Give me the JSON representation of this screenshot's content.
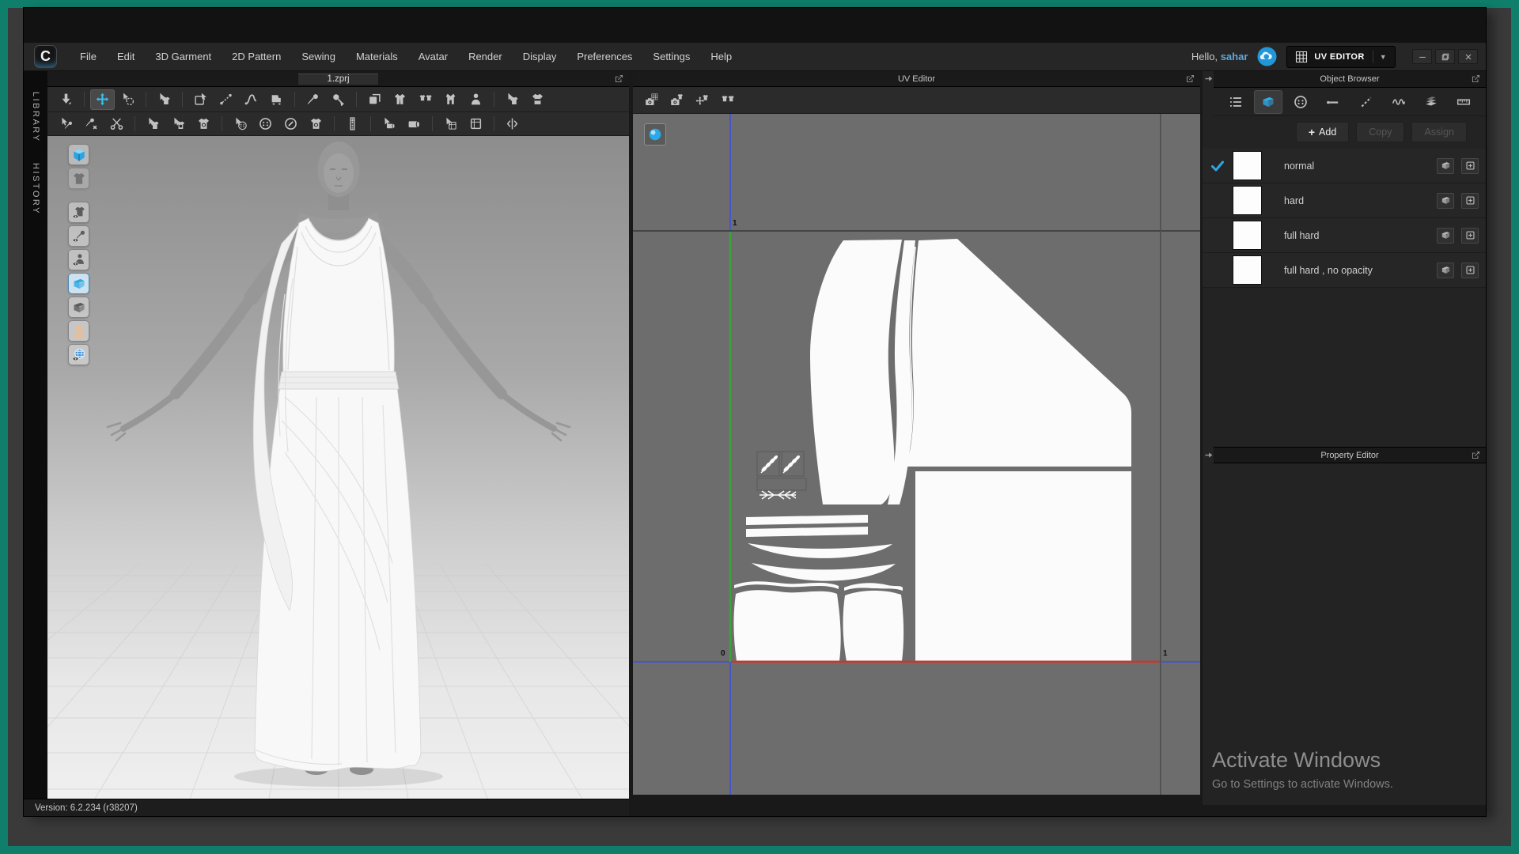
{
  "colors": {
    "frame_teal": "#0f7f6b",
    "accent_blue": "#2ba7e8",
    "account_name_blue": "#5fa8dd",
    "uv_left_edge_green": "#3aa33a",
    "uv_bottom_edge_red": "#c23b2e",
    "uv_axis_blue": "#4656c4",
    "uv_background_gray": "#6d6d6d"
  },
  "window": {
    "logo": "C",
    "menu_items": [
      "File",
      "Edit",
      "3D Garment",
      "2D Pattern",
      "Sewing",
      "Materials",
      "Avatar",
      "Render",
      "Display",
      "Preferences",
      "Settings",
      "Help"
    ],
    "greeting_prefix": "Hello,",
    "greeting_name": "sahar",
    "mode_switcher": {
      "label": "UV EDITOR",
      "icon": "uv-grid"
    },
    "controls": [
      {
        "name": "minimize",
        "glyph": "min"
      },
      {
        "name": "restore",
        "glyph": "restore"
      },
      {
        "name": "close",
        "glyph": "close"
      }
    ]
  },
  "left_rail": {
    "tabs": [
      {
        "name": "library",
        "label": "LIBRARY"
      },
      {
        "name": "history",
        "label": "HISTORY"
      }
    ]
  },
  "garment_panel": {
    "tab_title": "1.zprj",
    "version_label": "Version: 6.2.234 (r38207)",
    "toolbar_row1": [
      {
        "name": "simulate",
        "glyph": "arrowdown"
      },
      {
        "sep": true
      },
      {
        "name": "select-move",
        "glyph": "move",
        "active": true
      },
      {
        "name": "select-lasso",
        "glyph": "lasso"
      },
      {
        "sep": true
      },
      {
        "name": "select-mesh",
        "glyph": "cursshirt"
      },
      {
        "sep": true
      },
      {
        "name": "edit-pattern",
        "glyph": "sqcursor"
      },
      {
        "name": "edit-sewing",
        "glyph": "seam"
      },
      {
        "name": "free-sewing",
        "glyph": "curve"
      },
      {
        "name": "sewing-machine",
        "glyph": "machine"
      },
      {
        "sep": true
      },
      {
        "name": "pin-tack",
        "glyph": "pin"
      },
      {
        "name": "tack-on-avatar",
        "glyph": "pinball"
      },
      {
        "sep": true
      },
      {
        "name": "fold-arrangement",
        "glyph": "layers"
      },
      {
        "name": "solidify-garment",
        "glyph": "jacket"
      },
      {
        "name": "arrangement-points",
        "glyph": "shirts"
      },
      {
        "name": "bounding-volume",
        "glyph": "vest"
      },
      {
        "name": "avatar-tape",
        "glyph": "person"
      },
      {
        "sep": true
      },
      {
        "name": "garment-tape",
        "glyph": "cursshirt"
      },
      {
        "name": "garment-measure",
        "glyph": "shirtband"
      }
    ],
    "toolbar_row2": [
      {
        "name": "edit-pin",
        "glyph": "curspin"
      },
      {
        "name": "remove-pin",
        "glyph": "pinx"
      },
      {
        "name": "trim-cut",
        "glyph": "scissors"
      },
      {
        "sep": true
      },
      {
        "name": "edit-texture",
        "glyph": "cursshirt"
      },
      {
        "name": "edit-applique",
        "glyph": "cursbtnshirt"
      },
      {
        "name": "applique",
        "glyph": "btnshirt"
      },
      {
        "sep": true
      },
      {
        "name": "edit-button",
        "glyph": "cursbutton"
      },
      {
        "name": "button",
        "glyph": "button"
      },
      {
        "name": "buttonhole",
        "glyph": "buttonhole"
      },
      {
        "name": "attach-button",
        "glyph": "btnshirt"
      },
      {
        "sep": true
      },
      {
        "name": "zipper",
        "glyph": "zipper"
      },
      {
        "sep": true
      },
      {
        "name": "edit-fabric",
        "glyph": "cursroll"
      },
      {
        "name": "fabric-roll",
        "glyph": "roll"
      },
      {
        "sep": true
      },
      {
        "name": "edit-trim",
        "glyph": "cursswatch"
      },
      {
        "name": "trim-swatch",
        "glyph": "swatch"
      },
      {
        "sep": true
      },
      {
        "name": "fold-measure",
        "glyph": "foldarrows"
      }
    ],
    "view_toggles": [
      {
        "name": "render-style",
        "glyph": "cube"
      },
      {
        "name": "show-garment",
        "glyph": "shirt",
        "dim": true
      },
      {
        "name": "garment-visibility",
        "glyph": "shirteye"
      },
      {
        "name": "pin-visibility",
        "glyph": "pineye"
      },
      {
        "name": "avatar-visibility",
        "glyph": "personeye"
      },
      {
        "name": "fabric-front",
        "glyph": "fabricblue",
        "active": true
      },
      {
        "name": "fabric-back",
        "glyph": "fabricg"
      },
      {
        "name": "avatar-display",
        "glyph": "head"
      },
      {
        "name": "environment-display",
        "glyph": "globeeye"
      }
    ]
  },
  "uv_panel": {
    "title": "UV Editor",
    "toolbar": [
      {
        "name": "uv-snapshot",
        "glyph": "camgrid"
      },
      {
        "name": "garment-snapshot",
        "glyph": "camshirt"
      },
      {
        "name": "uv-move",
        "glyph": "moveshirt"
      },
      {
        "name": "uv-arrange",
        "glyph": "shirts"
      }
    ],
    "axis_labels": {
      "top": "1",
      "origin": "0",
      "right": "1"
    },
    "material_sphere": "material-sphere"
  },
  "object_browser": {
    "title": "Object Browser",
    "tabs": [
      {
        "name": "scene-list",
        "glyph": "list"
      },
      {
        "name": "fabric",
        "glyph": "fabricblue",
        "active": true
      },
      {
        "name": "button",
        "glyph": "button"
      },
      {
        "name": "topstitch",
        "glyph": "topstitch"
      },
      {
        "name": "stitch",
        "glyph": "dashline"
      },
      {
        "name": "puckering",
        "glyph": "squiggle"
      },
      {
        "name": "trim",
        "glyph": "trim"
      },
      {
        "name": "measure",
        "glyph": "measure"
      }
    ],
    "add_label": "Add",
    "copy_label": "Copy",
    "assign_label": "Assign",
    "fabrics": [
      {
        "label": "normal",
        "selected": true
      },
      {
        "label": "hard",
        "selected": false
      },
      {
        "label": "full hard",
        "selected": false
      },
      {
        "label": "full hard , no opacity",
        "selected": false
      }
    ],
    "row_icons": [
      {
        "name": "fabric-sheet",
        "glyph": "fabricg"
      },
      {
        "name": "assign-target",
        "glyph": "plusbox"
      }
    ]
  },
  "property_editor": {
    "title": "Property Editor"
  },
  "watermark": {
    "title": "Activate Windows",
    "subtitle": "Go to Settings to activate Windows."
  }
}
